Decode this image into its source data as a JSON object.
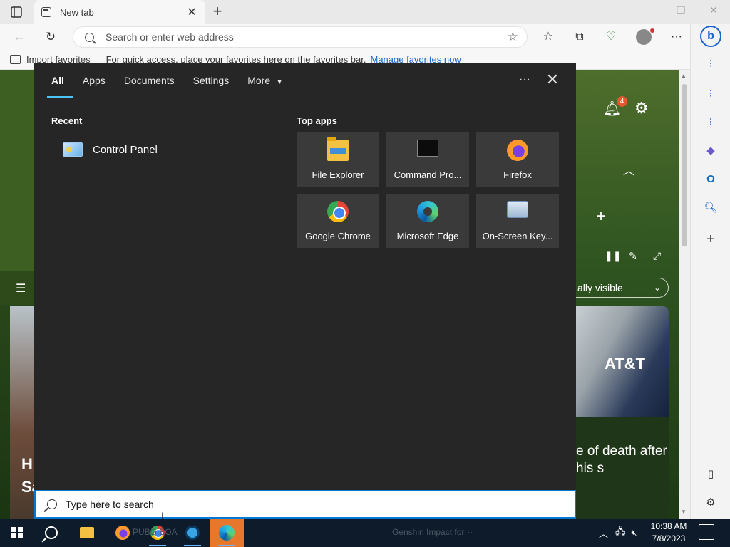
{
  "browser": {
    "tab": {
      "title": "New tab"
    },
    "address": {
      "placeholder": "Search or enter web address"
    },
    "favorites_bar": {
      "import_label": "Import favorites",
      "hint": "For quick access, place your favorites here on the favorites bar.",
      "link": "Manage favorites now"
    }
  },
  "page": {
    "notification_count": "4",
    "visibility_pill": "ally visible",
    "news_headline": "e of death after his s",
    "news_image_text": "AT&T",
    "left_card_title": "H Sa"
  },
  "search_panel": {
    "tabs": [
      "All",
      "Apps",
      "Documents",
      "Settings",
      "More"
    ],
    "active_tab": "All",
    "recent_title": "Recent",
    "recent_items": [
      {
        "label": "Control Panel",
        "icon": "control-panel-icon"
      }
    ],
    "top_apps_title": "Top apps",
    "top_apps": [
      {
        "label": "File Explorer",
        "icon": "file-explorer-icon"
      },
      {
        "label": "Command Pro...",
        "icon": "command-prompt-icon"
      },
      {
        "label": "Firefox",
        "icon": "firefox-icon"
      },
      {
        "label": "Google Chrome",
        "icon": "chrome-icon"
      },
      {
        "label": "Microsoft Edge",
        "icon": "edge-icon"
      },
      {
        "label": "On-Screen Key...",
        "icon": "on-screen-keyboard-icon"
      }
    ],
    "search_box": {
      "placeholder": "Type here to search",
      "value": ""
    }
  },
  "taskbar": {
    "ghost_text_1": "PUBG BOA",
    "ghost_text_2": "Genshin Impact for···",
    "clock": {
      "time": "10:38 AM",
      "date": "7/8/2023"
    }
  },
  "colors": {
    "accent": "#0078d4",
    "panel_bg": "#262626",
    "tile_bg": "#3a3a3a",
    "tab_underline": "#4cc2ff",
    "taskbar_active": "#e8772e"
  }
}
